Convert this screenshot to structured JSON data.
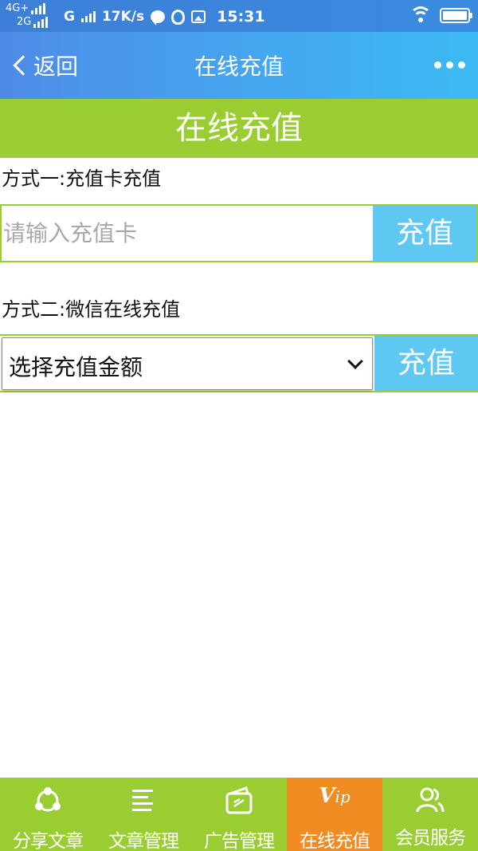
{
  "status_bar": {
    "network_1": "4G+",
    "network_2": "2G",
    "network_3": "G",
    "speed": "17K/s",
    "time": "15:31",
    "icons": [
      "signal-icon",
      "message-bubble-icon",
      "qq-icon",
      "gallery-icon",
      "wifi-icon",
      "battery-icon"
    ],
    "battery_level": 1.0
  },
  "header": {
    "back_label": "返回",
    "title": "在线充值",
    "more_icon": "more-dots-icon"
  },
  "banner": {
    "title": "在线充值"
  },
  "method_one": {
    "label": "方式一:充值卡充值",
    "input_placeholder": "请输入充值卡",
    "input_value": "",
    "button_label": "充值"
  },
  "method_two": {
    "label": "方式二:微信在线充值",
    "select_value": "选择充值金额",
    "button_label": "充值"
  },
  "tabbar": {
    "items": [
      {
        "label": "分享文章",
        "icon": "share-icon",
        "active": false
      },
      {
        "label": "文章管理",
        "icon": "article-list-icon",
        "active": false
      },
      {
        "label": "广告管理",
        "icon": "ad-card-icon",
        "active": false
      },
      {
        "label": "在线充值",
        "icon": "vip-icon",
        "icon_text": "V",
        "icon_text_small": "ip",
        "active": true
      },
      {
        "label": "会员服务",
        "icon": "members-icon",
        "active": false
      }
    ]
  },
  "colors": {
    "status_bar": "#3d7fd8",
    "header": "#45a7f0",
    "brand_green": "#9acd32",
    "button_blue": "#5ec8f2",
    "active_tab": "#f08c22"
  }
}
